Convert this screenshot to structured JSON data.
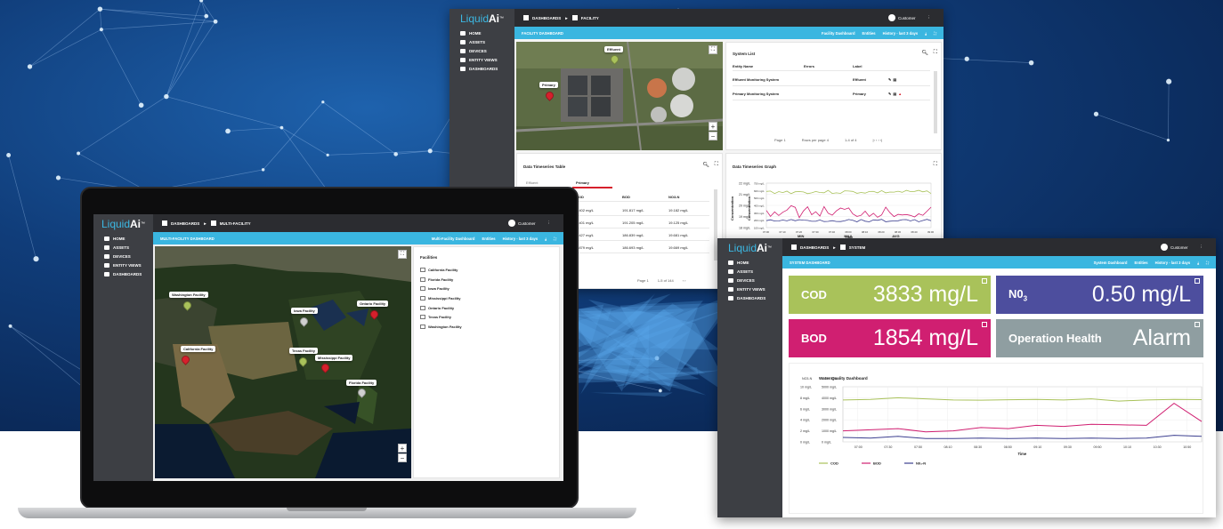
{
  "brand": {
    "logo_light": "Liquid",
    "logo_bold": "Ai",
    "logo_tm": "™"
  },
  "nav": [
    "HOME",
    "ASSETS",
    "DEVICES",
    "ENTITY VIEWS",
    "DASHBOARDS"
  ],
  "customer": "Customer",
  "facility": {
    "crumb1": "DASHBOARDS",
    "crumb_sep": "►",
    "crumb2": "FACILITY",
    "bar_title": "FACILITY DASHBOARD",
    "bar_select": "Facility Dashboard",
    "bar_entities": "Entities",
    "bar_history": "History - last 3 days",
    "map_pins": [
      "Effluent",
      "Primary"
    ],
    "system_list": {
      "title": "System List",
      "headers": [
        "Entity Name",
        "Errors",
        "Label"
      ],
      "rows": [
        {
          "name": "Effluent Monitoring System",
          "errors": "",
          "label": "Effluent"
        },
        {
          "name": "Primary Monitoring System",
          "errors": "",
          "label": "Primary"
        }
      ],
      "footer_page": "Page 1",
      "footer_rows": "Rows per page 4",
      "footer_count": "1-4 of 4"
    },
    "ts_table": {
      "title": "Data Timeseries Table",
      "tabs": [
        "Effluent",
        "Primary"
      ],
      "headers": [
        "COD",
        "BOD",
        "NO3-N"
      ],
      "rows": [
        [
          "1,402 mg/L",
          "191.817 mg/L",
          "19.182 mg/L"
        ],
        [
          "3,401 mg/L",
          "191.205 mg/L",
          "19.125 mg/L"
        ],
        [
          "7,427 mg/L",
          "186.839 mg/L",
          "19.681 mg/L"
        ],
        [
          "0,879 mg/L",
          "186.693 mg/L",
          "19.669 mg/L"
        ]
      ],
      "footer_page": "Page 1",
      "footer_count": "1-5 of 144"
    },
    "ts_graph": {
      "title": "Data Timeseries Graph",
      "yticks_left": [
        "22 mg/L",
        "21 mg/L",
        "20 mg/L",
        "19 mg/L",
        "18 mg/L"
      ],
      "yticks_right": [
        "750 mg/L",
        "600 mg/L",
        "500 mg/L",
        "400 mg/L",
        "300 mg/L",
        "200 mg/L",
        "100 mg/L"
      ],
      "xticks": [
        "07:00",
        "07:10",
        "07:20",
        "07:30",
        "07:40",
        "08:00",
        "08:10",
        "08:20",
        "08:30",
        "08:40",
        "09:00"
      ],
      "xlabel": "Time",
      "ylabel_left": "Concentration",
      "ylabel_right": "Concentration",
      "stat_headers": [
        "MIN",
        "MAX",
        "AVG"
      ]
    }
  },
  "multi": {
    "crumb1": "DASHBOARDS",
    "crumb_sep": "►",
    "crumb2": "MULTI-FACILITY",
    "bar_title": "MULTI-FACILITY DASHBOARD",
    "bar_select": "Multi-Facility Dashboard",
    "bar_entities": "Entities",
    "bar_history": "History - last 3 days",
    "facilities_title": "Facilities",
    "facilities": [
      "California Facility",
      "Florida Facility",
      "Iowa Facility",
      "Mississippi Facility",
      "Ontario Facility",
      "Texas Facility",
      "Washington Facility"
    ],
    "pins": [
      "Washington Facility",
      "Iowa Facility",
      "Ontario Facility",
      "California Facility",
      "Texas Facility",
      "Mississippi Facility",
      "Florida Facility"
    ]
  },
  "system": {
    "crumb1": "DASHBOARDS",
    "crumb_sep": "►",
    "crumb2": "SYSTEM",
    "bar_title": "SYSTEM DASHBOARD",
    "bar_select": "System Dashboard",
    "bar_entities": "Entities",
    "bar_history": "History - last 3 days",
    "tiles": [
      {
        "label": "COD",
        "value": "3833 mg/L",
        "color": "#a9c25a"
      },
      {
        "label": "N0",
        "sub": "3",
        "value": "0.50 mg/L",
        "color": "#4d4e9e"
      },
      {
        "label": "BOD",
        "value": "1854 mg/L",
        "color": "#d01f71"
      },
      {
        "label": "Operation Health",
        "value": "Alarm",
        "color": "#8f9ea1"
      }
    ],
    "chart_data": {
      "type": "line",
      "title": "Water Quality Dashboard",
      "ylabel_left": "NO3-N",
      "ylabel_right": "COD/BOD",
      "yticks_left": [
        "10 mg/L",
        "8 mg/L",
        "6 mg/L",
        "4 mg/L",
        "2 mg/L",
        "0 mg/L"
      ],
      "yticks_right": [
        "5000 mg/L",
        "4000 mg/L",
        "3000 mg/L",
        "2000 mg/L",
        "1000 mg/L",
        "0 mg/L"
      ],
      "x": [
        "07:00",
        "07:30",
        "07:50",
        "08:10",
        "08:30",
        "08:50",
        "09:10",
        "09:30",
        "09:50",
        "10:10",
        "10:30",
        "10:50"
      ],
      "xlabel": "Time",
      "series": [
        {
          "name": "COD",
          "color": "#a9c25a",
          "values": [
            3800,
            3850,
            4000,
            3900,
            3800,
            3780,
            3820,
            3850,
            3800,
            3900,
            3700,
            3800,
            3850,
            3830
          ]
        },
        {
          "name": "BOD",
          "color": "#d01f71",
          "values": [
            1000,
            1100,
            1200,
            900,
            1000,
            1300,
            1200,
            1500,
            1400,
            1600,
            1550,
            1500,
            3500,
            1850
          ]
        },
        {
          "name": "N0₃-N",
          "color": "#3c3f8f",
          "values": [
            400,
            350,
            500,
            300,
            300,
            350,
            300,
            350,
            300,
            350,
            300,
            350,
            600,
            500
          ]
        }
      ],
      "ylim": [
        0,
        5000
      ]
    }
  }
}
